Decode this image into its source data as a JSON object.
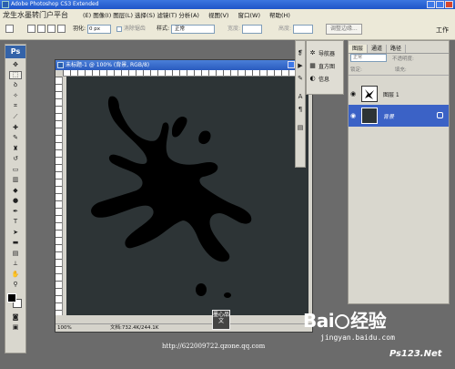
{
  "window": {
    "title": "Adobe Photoshop CS3 Extended"
  },
  "menu": {
    "logo_text": "龙生水墨转门户平台",
    "items": [
      "视图(V)",
      "窗口(W)",
      "帮助(H)"
    ],
    "hidden_items_text": "(E) 图像(I) 图层(L) 选择(S) 滤镜(T) 分析(A)"
  },
  "options": {
    "feather_label": "羽化:",
    "feather_value": "0 px",
    "antialias_label": "消除锯齿",
    "style_label": "样式:",
    "style_value": "正常",
    "width_label": "宽度:",
    "height_label": "高度:",
    "refine_edge_label": "调整边缘...",
    "workspace_label": "工作"
  },
  "toolbox": {
    "logo": "Ps"
  },
  "document": {
    "title": "未标题-1 @ 100% (背景, RGB/8)",
    "zoom": "100%",
    "doc_info": "文档:732.4K/244.1K"
  },
  "nav_panel": {
    "items": [
      {
        "label": "导航器",
        "icon": "navigator-icon"
      },
      {
        "label": "直方图",
        "icon": "histogram-icon"
      },
      {
        "label": "信息",
        "icon": "info-icon"
      }
    ]
  },
  "layers_panel": {
    "tabs": [
      "图层",
      "通道",
      "路径"
    ],
    "blend_mode": "正常",
    "opacity_label": "不透明度:",
    "lock_label": "锁定:",
    "fill_label": "填充:",
    "layers": [
      {
        "name": "图层 1",
        "visible": true,
        "active": false
      },
      {
        "name": "背景",
        "visible": true,
        "active": true
      }
    ]
  },
  "colors": {
    "foreground": "#000000",
    "background": "#ffffff",
    "canvas": "#2d3436"
  },
  "watermarks": {
    "url": "http://622009722.qzone.qq.com",
    "seal": "墨心品文",
    "baidu": "Bai",
    "baidu_suffix": "经验",
    "jingyan": "jingyan.baidu.com",
    "ps123": "Ps123.Net"
  }
}
